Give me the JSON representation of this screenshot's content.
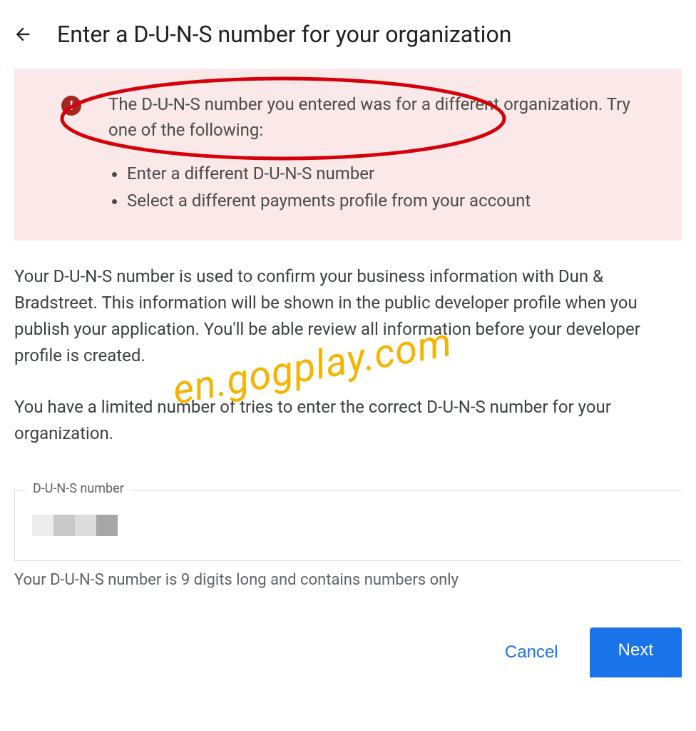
{
  "header": {
    "title": "Enter a D-U-N-S number for your organization"
  },
  "alert": {
    "message": "The D-U-N-S number you entered was for a different organization. Try one of the following:",
    "options": [
      "Enter a different D-U-N-S number",
      "Select a different payments profile from your account"
    ]
  },
  "body": {
    "para1": "Your D-U-N-S number is used to confirm your business information with Dun & Bradstreet. This information will be shown in the public developer profile when you publish your application. You'll be able review all information before your developer profile is created.",
    "para2": "You have a limited number of tries to enter the correct D-U-N-S number for your organization."
  },
  "field": {
    "label": "D-U-N-S number",
    "helper": "Your D-U-N-S number is 9 digits long and contains numbers only"
  },
  "buttons": {
    "cancel": "Cancel",
    "next": "Next"
  },
  "watermark": "en.gogplay.com"
}
